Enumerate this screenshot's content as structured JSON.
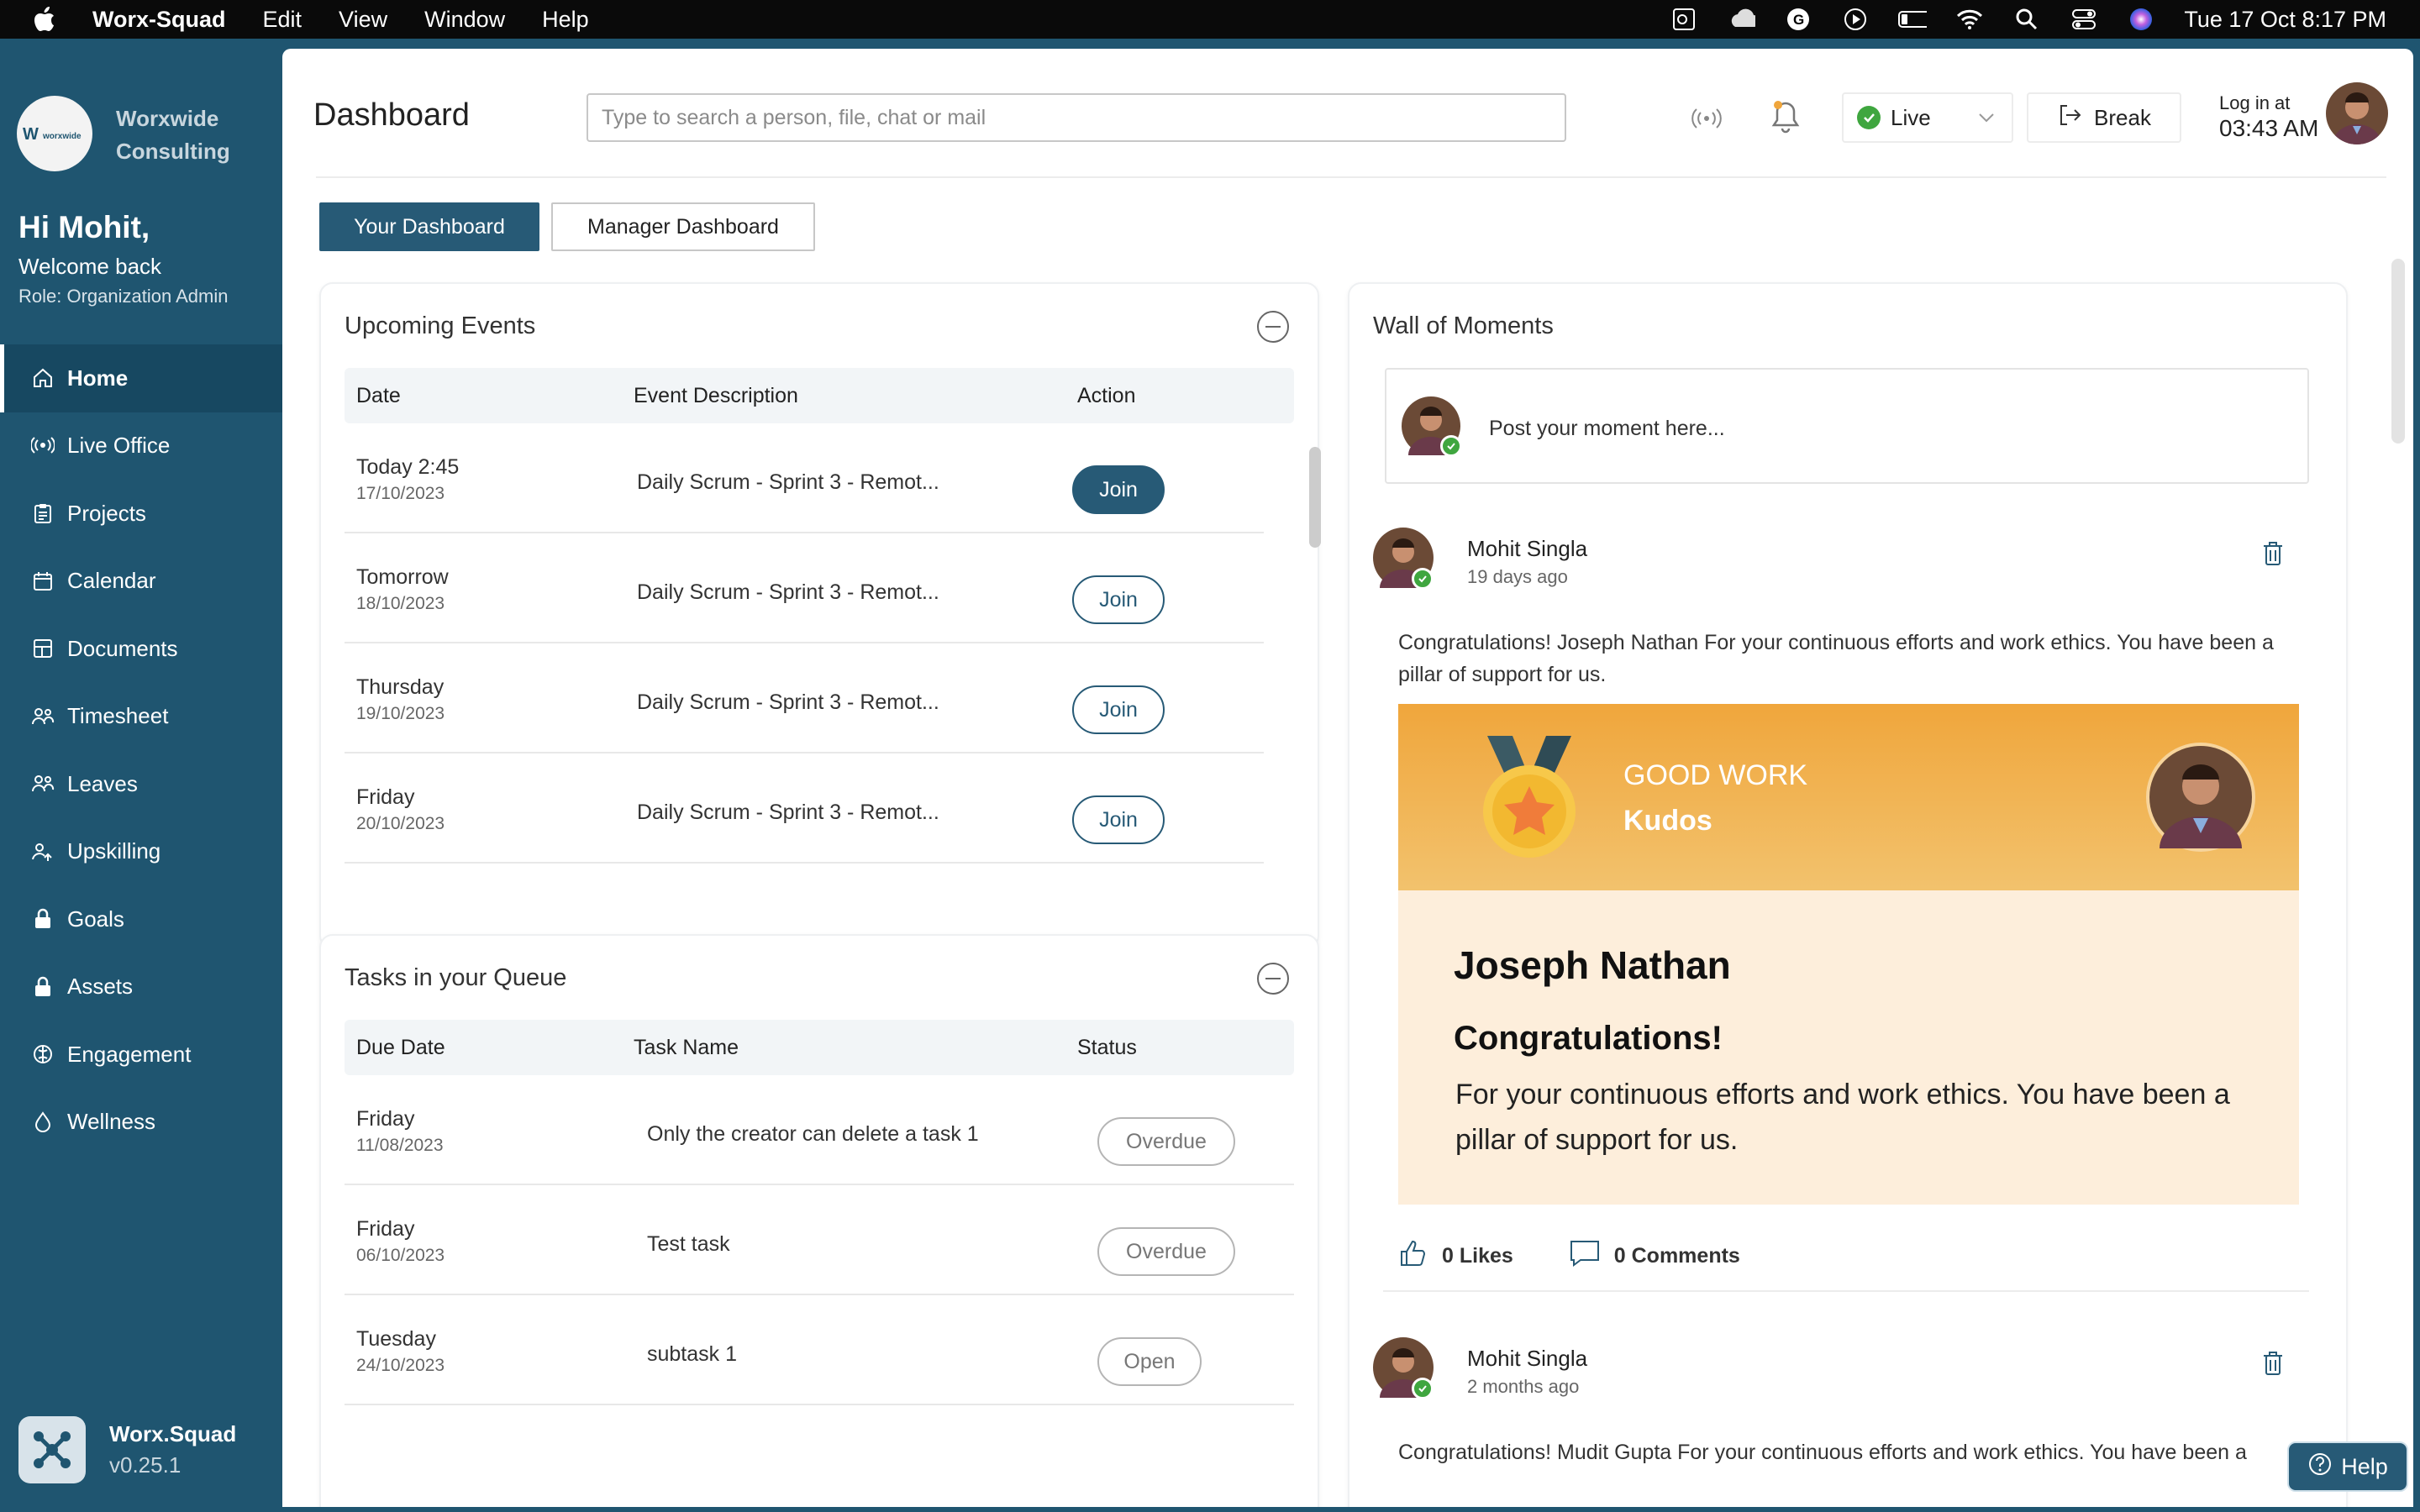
{
  "menubar": {
    "app_name": "Worx-Squad",
    "menus": [
      "Edit",
      "View",
      "Window",
      "Help"
    ],
    "datetime": "Tue 17 Oct  8:17 PM"
  },
  "sidebar": {
    "org_name_line1": "Worxwide",
    "org_name_line2": "Consulting",
    "logo_text": "worxwide",
    "greeting": "Hi Mohit,",
    "welcome": "Welcome back",
    "role": "Role: Organization Admin",
    "items": [
      {
        "label": "Home",
        "icon": "home-icon",
        "active": true
      },
      {
        "label": "Live Office",
        "icon": "broadcast-icon"
      },
      {
        "label": "Projects",
        "icon": "clipboard-icon"
      },
      {
        "label": "Calendar",
        "icon": "calendar-icon"
      },
      {
        "label": "Documents",
        "icon": "documents-icon"
      },
      {
        "label": "Timesheet",
        "icon": "team-icon"
      },
      {
        "label": "Leaves",
        "icon": "people-icon"
      },
      {
        "label": "Upskilling",
        "icon": "upskilling-icon"
      },
      {
        "label": "Goals",
        "icon": "lock-icon"
      },
      {
        "label": "Assets",
        "icon": "lock-icon"
      },
      {
        "label": "Engagement",
        "icon": "engagement-icon"
      },
      {
        "label": "Wellness",
        "icon": "drop-icon"
      }
    ],
    "brand_name": "Worx.Squad",
    "version": "v0.25.1"
  },
  "header": {
    "title": "Dashboard",
    "search_placeholder": "Type to search a person, file, chat or mail",
    "status": "Live",
    "break_label": "Break",
    "login_label": "Log in at",
    "login_time": "03:43 AM"
  },
  "tabs": {
    "your": "Your Dashboard",
    "manager": "Manager Dashboard"
  },
  "events": {
    "title": "Upcoming Events",
    "columns": [
      "Date",
      "Event Description",
      "Action"
    ],
    "rows": [
      {
        "day": "Today 2:45",
        "date": "17/10/2023",
        "desc": "Daily Scrum - Sprint 3 - Remot...",
        "action": "Join"
      },
      {
        "day": "Tomorrow",
        "date": "18/10/2023",
        "desc": "Daily Scrum - Sprint 3 - Remot...",
        "action": "Join"
      },
      {
        "day": "Thursday",
        "date": "19/10/2023",
        "desc": "Daily Scrum - Sprint 3 - Remot...",
        "action": "Join"
      },
      {
        "day": "Friday",
        "date": "20/10/2023",
        "desc": "Daily Scrum - Sprint 3 - Remot...",
        "action": "Join"
      }
    ]
  },
  "tasks": {
    "title": "Tasks in your Queue",
    "columns": [
      "Due Date",
      "Task Name",
      "Status"
    ],
    "rows": [
      {
        "day": "Friday",
        "date": "11/08/2023",
        "name": "Only the creator can delete a task 1",
        "status": "Overdue"
      },
      {
        "day": "Friday",
        "date": "06/10/2023",
        "name": "Test task",
        "status": "Overdue"
      },
      {
        "day": "Tuesday",
        "date": "24/10/2023",
        "name": "subtask 1",
        "status": "Open"
      }
    ]
  },
  "wall": {
    "title": "Wall of Moments",
    "post_placeholder": "Post your moment here...",
    "posts": [
      {
        "author": "Mohit Singla",
        "time": "19 days ago",
        "text": "Congratulations! Joseph Nathan For your continuous efforts and work ethics. You have been a pillar of support for us.",
        "kudos": {
          "header": "GOOD WORK",
          "sub": "Kudos",
          "recipient": "Joseph Nathan",
          "congrats": "Congratulations!",
          "message": "For your continuous efforts and work ethics. You have been a pillar of support for us."
        },
        "likes": "0 Likes",
        "comments": "0 Comments"
      },
      {
        "author": "Mohit Singla",
        "time": "2 months ago",
        "text": "Congratulations! Mudit Gupta For your continuous efforts and work ethics. You have been a"
      }
    ]
  },
  "help_label": "Help",
  "colors": {
    "primary": "#275a76",
    "sidebar": "#1f5570",
    "online": "#3fa63f",
    "kudos": "#f0a63c"
  }
}
